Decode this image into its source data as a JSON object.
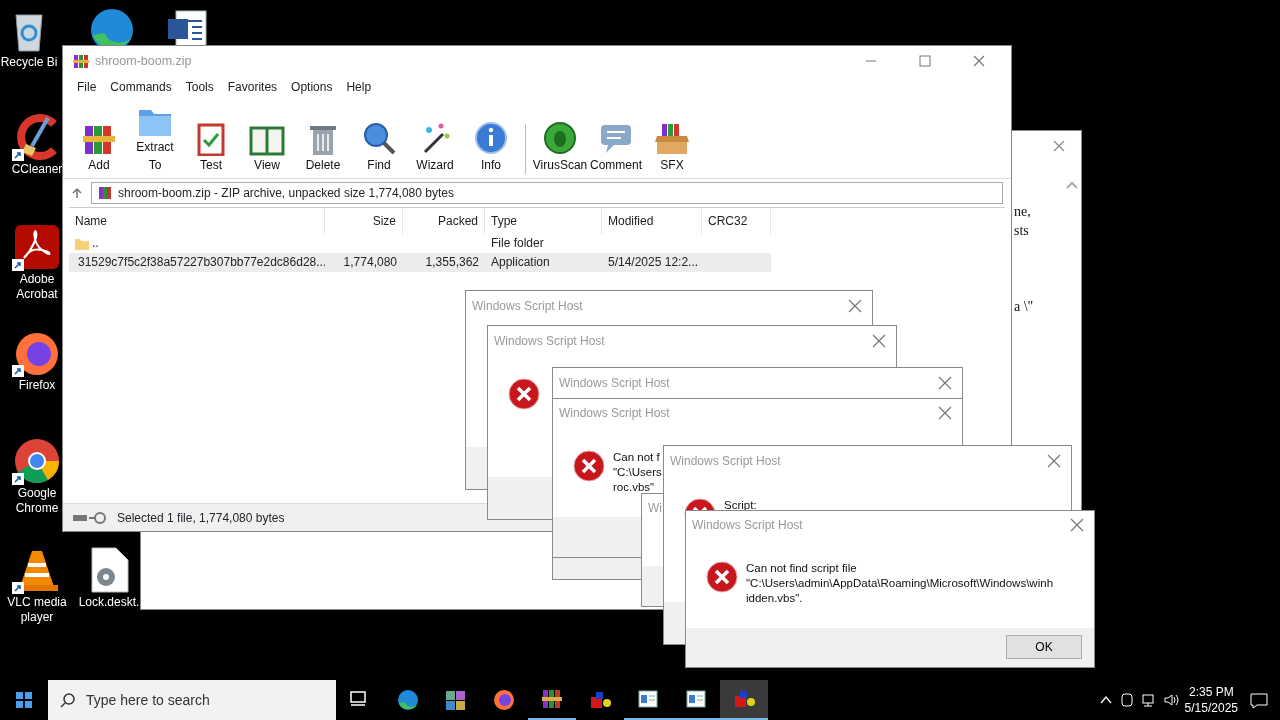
{
  "desktop_icons": [
    {
      "kind": "recycle",
      "label": "Recycle Bi",
      "shortcut": false
    },
    {
      "kind": "edge",
      "shortcut": false
    },
    {
      "kind": "word",
      "shortcut": false
    },
    {
      "kind": "ccleaner",
      "label": "CCleaner",
      "shortcut": true
    },
    {
      "kind": "acrobat",
      "label": "Adobe Acrobat",
      "shortcut": true
    },
    {
      "kind": "firefox",
      "label": "Firefox",
      "shortcut": true
    },
    {
      "kind": "chrome",
      "label": "Google Chrome",
      "shortcut": true
    },
    {
      "kind": "vlc",
      "label": "VLC media player",
      "shortcut": true
    },
    {
      "kind": "file",
      "label": "Lock.deskt.",
      "shortcut": false
    }
  ],
  "background_window": {
    "fragments": [
      "ne,",
      "sts",
      "a \\\""
    ]
  },
  "archive_window": {
    "title": "shroom-boom.zip",
    "menu": [
      "File",
      "Commands",
      "Tools",
      "Favorites",
      "Options",
      "Help"
    ],
    "toolbar": [
      {
        "kind": "add",
        "label": "Add"
      },
      {
        "kind": "extract",
        "label": "Extract To"
      },
      {
        "kind": "test",
        "label": "Test"
      },
      {
        "kind": "view",
        "label": "View"
      },
      {
        "kind": "delete",
        "label": "Delete"
      },
      {
        "kind": "find",
        "label": "Find"
      },
      {
        "kind": "wizard",
        "label": "Wizard"
      },
      {
        "kind": "info",
        "label": "Info"
      },
      {
        "kind": "virusscan",
        "label": "VirusScan"
      },
      {
        "kind": "comment",
        "label": "Comment"
      },
      {
        "kind": "sfx",
        "label": "SFX"
      }
    ],
    "address": "shroom-boom.zip - ZIP archive, unpacked size 1,774,080 bytes",
    "columns": [
      "Name",
      "Size",
      "Packed",
      "Type",
      "Modified",
      "CRC32"
    ],
    "rows": [
      {
        "kind": "folder",
        "name": "..",
        "type": "File folder",
        "selected": false
      },
      {
        "kind": "app",
        "name": "31529c7f5c2f38a57227b307bb77e2dc86d28...",
        "size": "1,774,080",
        "packed": "1,355,362",
        "type": "Application",
        "modified": "5/14/2025 12:2...",
        "selected": true
      }
    ],
    "status": "Selected 1 file, 1,774,080 bytes"
  },
  "dialogs": [
    {
      "title": "Windows Script Host",
      "error_icon": false
    },
    {
      "title": "Windows Script Host",
      "error_icon": true
    },
    {
      "title": "Windows Script Host",
      "error_icon": false
    },
    {
      "title": "Windows Script Host",
      "error_icon": true,
      "message": [
        "Can not f",
        "\"C:\\Users",
        "roc.vbs\""
      ]
    },
    {
      "title": "Wi",
      "error_icon": false
    },
    {
      "title": "Windows Script Host",
      "error_icon": true,
      "message": [
        "Script:"
      ]
    },
    {
      "title": "Windows Script Host",
      "error_icon": true,
      "message": [
        "Can not find script file",
        "\"C:\\Users\\admin\\AppData\\Roaming\\Microsoft\\Windows\\winh",
        "idden.vbs\"."
      ],
      "button": "OK"
    }
  ],
  "taskbar": {
    "search": {
      "placeholder": "Type here to search"
    },
    "apps": [
      {
        "kind": "taskview",
        "running": false,
        "selected": false
      },
      {
        "kind": "edge",
        "running": false,
        "selected": false
      },
      {
        "kind": "tiles",
        "running": false,
        "selected": false
      },
      {
        "kind": "firefox",
        "running": false,
        "selected": false
      },
      {
        "kind": "winrar",
        "running": true,
        "selected": false
      },
      {
        "kind": "script",
        "running": false,
        "selected": false
      },
      {
        "kind": "window",
        "running": true,
        "selected": false
      },
      {
        "kind": "window",
        "running": true,
        "selected": false
      },
      {
        "kind": "script",
        "running": true,
        "selected": true
      }
    ],
    "time": "2:35 PM",
    "date": "5/15/2025"
  }
}
